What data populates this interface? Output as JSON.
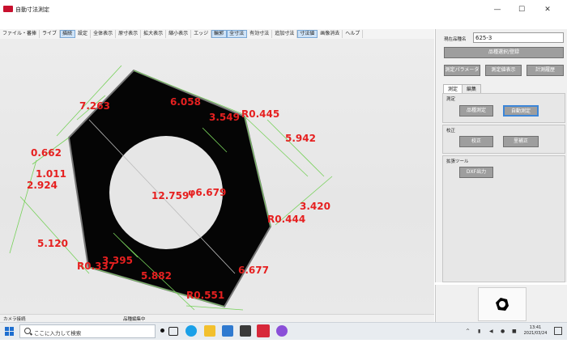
{
  "window": {
    "title": "自動寸法測定",
    "min_glyph": "—",
    "max_glyph": "☐",
    "close_glyph": "✕"
  },
  "menu": [
    {
      "label": "ファイル・蕃捧",
      "active": false
    },
    {
      "label": "ライブ",
      "active": false
    },
    {
      "label": "描続",
      "active": true
    },
    {
      "label": "設定",
      "active": false
    },
    {
      "label": "全体表示",
      "active": false
    },
    {
      "label": "原寸表示",
      "active": false
    },
    {
      "label": "拡大表示",
      "active": false
    },
    {
      "label": "縮小表示",
      "active": false
    },
    {
      "label": "エッジ",
      "active": false
    },
    {
      "label": "輪郭",
      "active": true
    },
    {
      "label": "全寸法",
      "active": true
    },
    {
      "label": "有効寸法",
      "active": false
    },
    {
      "label": "追加寸法",
      "active": false
    },
    {
      "label": "寸法値",
      "active": true
    },
    {
      "label": "画像消去",
      "active": false
    },
    {
      "label": "ヘルプ",
      "active": false
    }
  ],
  "dimensions": [
    "7.263",
    "6.058",
    "3.549",
    "R0.445",
    "5.942",
    "0.662",
    "1.011",
    "2.924",
    "12.759",
    "φ6.679",
    "3.420",
    "R0.444",
    "5.120",
    "R0.337",
    "3.395",
    "5.882",
    "6.677",
    "R0.551"
  ],
  "status": {
    "camera": "カメラ接続",
    "editing": "品種編集中"
  },
  "panel": {
    "product_label": "現在品種名",
    "product_name": "625-3",
    "select_button": "品種選択/登録",
    "param_button": "測定パラメータ",
    "values_button": "測定値表示",
    "history_button": "計測履歴",
    "tabs": [
      {
        "label": "測定",
        "active": true
      },
      {
        "label": "編集",
        "active": false
      }
    ],
    "measure_group": "測定",
    "quality_button": "品種測定",
    "auto_button": "自動測定",
    "calib_group": "校正",
    "calib_button": "校正",
    "recalib_button": "里補正",
    "ext_group": "拡張ツール",
    "dxf_button": "DXF出力"
  },
  "taskbar": {
    "search_placeholder": "ここに入力して検索",
    "time": "13:41",
    "date": "2021/03/24"
  }
}
